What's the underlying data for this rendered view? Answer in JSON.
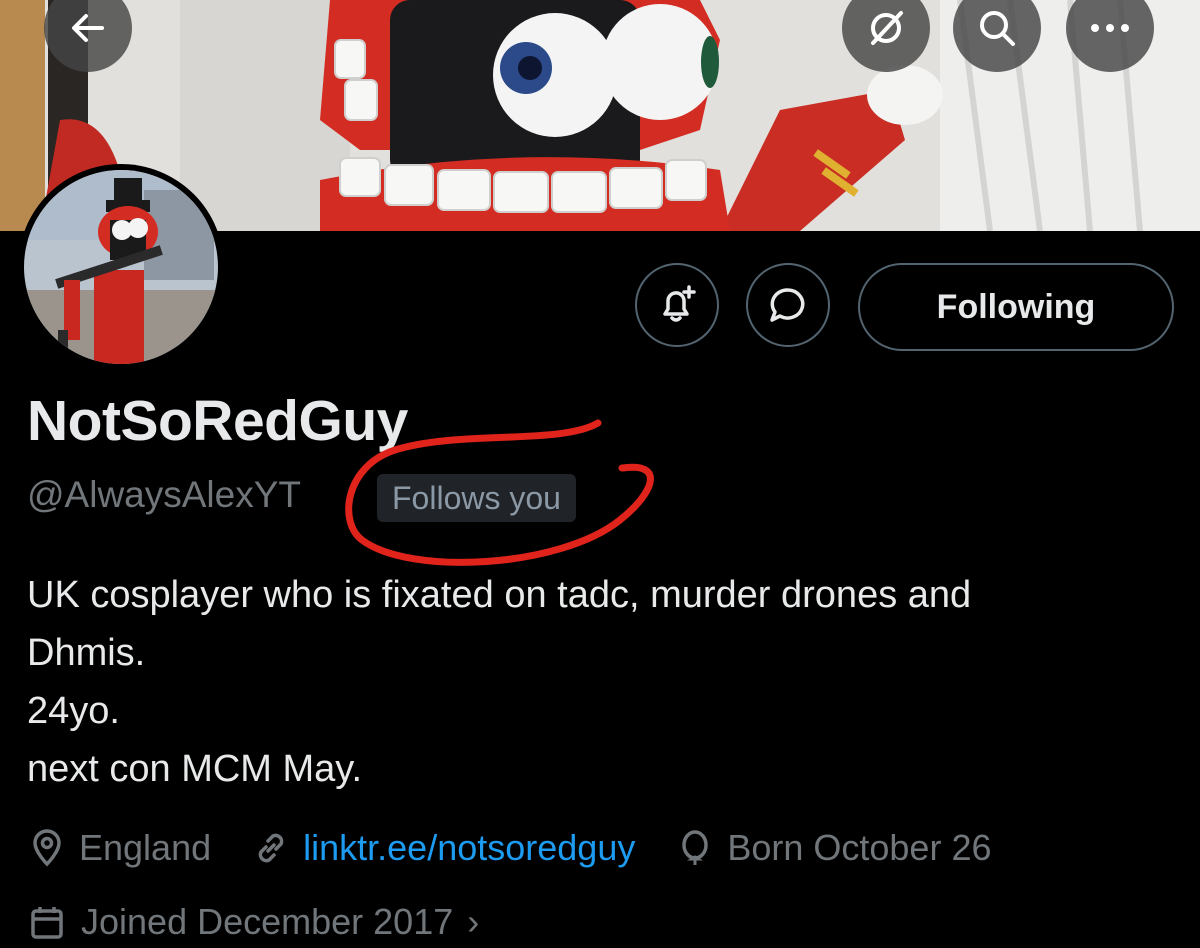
{
  "profile": {
    "display_name": "NotSoRedGuy",
    "handle": "@AlwaysAlexYT",
    "follows_you_badge": "Follows you",
    "bio": "UK cosplayer who is fixated on tadc, murder drones and\nDhmis.\n24yo.\nnext con MCM May.",
    "location": "England",
    "website": "linktr.ee/notsoredguy",
    "birthday": "Born October 26",
    "joined": "Joined December 2017"
  },
  "actions": {
    "following_label": "Following"
  },
  "header_icons": [
    "back-arrow-icon",
    "grok-icon",
    "search-icon",
    "more-icon"
  ],
  "colors": {
    "background": "#000000",
    "primary_text": "#e7e9ea",
    "secondary_text": "#71767b",
    "link": "#1d9bf0",
    "border": "#536471",
    "annotation": "#e0241b"
  }
}
